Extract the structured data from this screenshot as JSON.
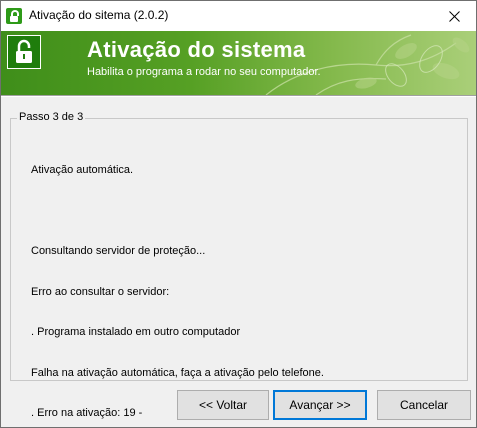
{
  "window": {
    "title": "Ativação do sitema (2.0.2)"
  },
  "banner": {
    "title": "Ativação do sistema",
    "subtitle": "Habilita o programa a rodar no seu computador."
  },
  "step": {
    "label": "Passo 3 de 3"
  },
  "log": {
    "lines": [
      "Ativação automática.",
      "",
      "Consultando servidor de proteção...",
      "Erro ao consultar o servidor:",
      ". Programa instalado em outro computador",
      "Falha na ativação automática, faça a ativação pelo telefone.",
      ". Erro na ativação: 19 -"
    ]
  },
  "buttons": {
    "back": "<< Voltar",
    "next": "Avançar >>",
    "cancel": "Cancelar"
  },
  "colors": {
    "banner_green": "#56a024",
    "focus_blue": "#0078d7"
  },
  "icons": {
    "app": "lock-icon",
    "banner": "lock-icon",
    "close": "close-icon"
  }
}
